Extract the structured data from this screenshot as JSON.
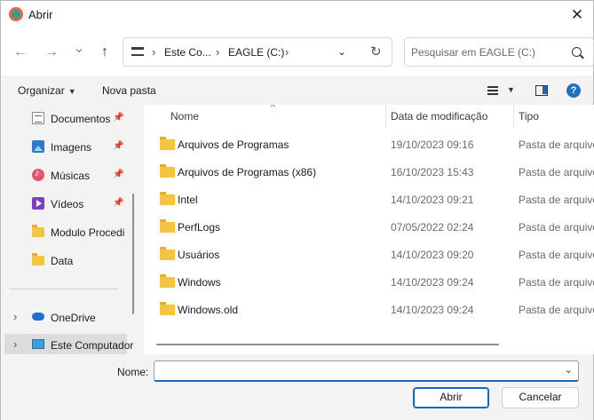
{
  "window": {
    "title": "Abrir",
    "close_glyph": "✕"
  },
  "nav": {
    "back_glyph": "←",
    "forward_glyph": "→",
    "recent_glyph": "⌄",
    "up_glyph": "↑",
    "breadcrumb": [
      "Este Co...",
      "EAGLE (C:)"
    ],
    "sep_glyph": "›",
    "dropdown_glyph": "⌄",
    "refresh_glyph": "↻",
    "search_placeholder": "Pesquisar em EAGLE (C:)"
  },
  "toolbar": {
    "organize_label": "Organizar",
    "new_folder_label": "Nova pasta",
    "caret_glyph": "▼",
    "help_glyph": "?"
  },
  "sidebar": {
    "pin_glyph": "📌",
    "chevron_glyph": "›",
    "items": [
      {
        "label": "Documentos",
        "icon": "document-icon",
        "pinned": true
      },
      {
        "label": "Imagens",
        "icon": "pictures-icon",
        "pinned": true
      },
      {
        "label": "Músicas",
        "icon": "music-icon",
        "pinned": true
      },
      {
        "label": "Vídeos",
        "icon": "videos-icon",
        "pinned": true
      },
      {
        "label": "Modulo Procedi",
        "icon": "folder-icon",
        "pinned": false
      },
      {
        "label": "Data",
        "icon": "folder-icon",
        "pinned": false
      }
    ],
    "locations": [
      {
        "label": "OneDrive",
        "icon": "cloud-icon"
      },
      {
        "label": "Este Computador",
        "icon": "computer-icon",
        "selected": true
      }
    ]
  },
  "filelist": {
    "columns": [
      "Nome",
      "Data de modificação",
      "Tipo"
    ],
    "sort_glyph": "^",
    "rows": [
      {
        "name": "Arquivos de Programas",
        "date": "19/10/2023 09:16",
        "type": "Pasta de arquivos"
      },
      {
        "name": "Arquivos de Programas (x86)",
        "date": "16/10/2023 15:43",
        "type": "Pasta de arquivos"
      },
      {
        "name": "Intel",
        "date": "14/10/2023 09:21",
        "type": "Pasta de arquivos"
      },
      {
        "name": "PerfLogs",
        "date": "07/05/2022 02:24",
        "type": "Pasta de arquivos"
      },
      {
        "name": "Usuários",
        "date": "14/10/2023 09:20",
        "type": "Pasta de arquivos"
      },
      {
        "name": "Windows",
        "date": "14/10/2023 09:24",
        "type": "Pasta de arquivos"
      },
      {
        "name": "Windows.old",
        "date": "14/10/2023 09:24",
        "type": "Pasta de arquivos"
      }
    ]
  },
  "footer": {
    "name_label": "Nome:",
    "name_value": "",
    "dropdown_glyph": "⌄",
    "open_label": "Abrir",
    "cancel_label": "Cancelar"
  },
  "colors": {
    "accent": "#1567c0",
    "folder": "#f4c542",
    "background": "#f3f3f3"
  }
}
